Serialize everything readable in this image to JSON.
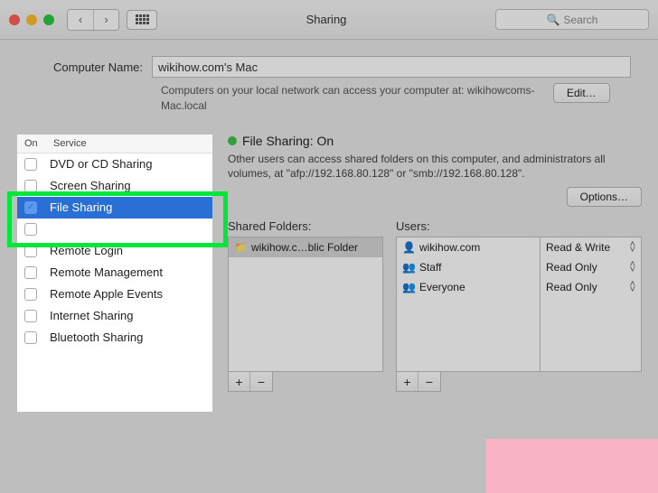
{
  "window": {
    "title": "Sharing"
  },
  "search": {
    "placeholder": "Search"
  },
  "computer_name": {
    "label": "Computer Name:",
    "value": "wikihow.com's Mac",
    "subtext": "Computers on your local network can access your computer at: wikihowcoms-Mac.local",
    "edit_label": "Edit…"
  },
  "services": {
    "head_on": "On",
    "head_service": "Service",
    "items": [
      {
        "label": "DVD or CD Sharing",
        "checked": false,
        "selected": false
      },
      {
        "label": "Screen Sharing",
        "checked": false,
        "selected": false
      },
      {
        "label": "File Sharing",
        "checked": true,
        "selected": true
      },
      {
        "label": "",
        "checked": false,
        "selected": false
      },
      {
        "label": "Remote Login",
        "checked": false,
        "selected": false
      },
      {
        "label": "Remote Management",
        "checked": false,
        "selected": false
      },
      {
        "label": "Remote Apple Events",
        "checked": false,
        "selected": false
      },
      {
        "label": "Internet Sharing",
        "checked": false,
        "selected": false
      },
      {
        "label": "Bluetooth Sharing",
        "checked": false,
        "selected": false
      }
    ]
  },
  "status": {
    "title": "File Sharing: On",
    "desc": "Other users can access shared folders on this computer, and administrators all volumes, at \"afp://192.168.80.128\" or \"smb://192.168.80.128\".",
    "options_label": "Options…"
  },
  "folders": {
    "title": "Shared Folders:",
    "items": [
      {
        "label": "wikihow.c…blic Folder"
      }
    ]
  },
  "users": {
    "title": "Users:",
    "items": [
      {
        "icon": "👤",
        "label": "wikihow.com"
      },
      {
        "icon": "👥",
        "label": "Staff"
      },
      {
        "icon": "👥",
        "label": "Everyone"
      }
    ]
  },
  "perms": {
    "items": [
      {
        "label": "Read & Write"
      },
      {
        "label": "Read Only"
      },
      {
        "label": "Read Only"
      }
    ]
  },
  "glyphs": {
    "plus": "+",
    "minus": "−",
    "back": "‹",
    "fwd": "›",
    "search": "🔍",
    "up": "˄",
    "down": "˅",
    "folder": "📁"
  }
}
